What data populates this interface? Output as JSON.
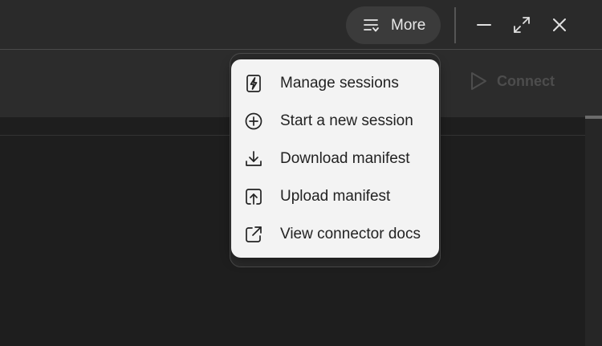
{
  "header": {
    "more_label": "More",
    "icons": {
      "more": "menu-list-icon",
      "minimize": "minimize-icon",
      "maximize": "maximize-icon",
      "close": "close-icon"
    }
  },
  "toolbar": {
    "connect_label": "Connect",
    "connect_icon": "play-icon"
  },
  "menu": {
    "items": [
      {
        "label": "Manage sessions",
        "icon": "lightning-document-icon"
      },
      {
        "label": "Start a new session",
        "icon": "plus-circle-icon"
      },
      {
        "label": "Download manifest",
        "icon": "download-icon"
      },
      {
        "label": "Upload manifest",
        "icon": "upload-icon"
      },
      {
        "label": "View connector docs",
        "icon": "external-link-icon"
      }
    ]
  },
  "colors": {
    "background": "#1e1e1e",
    "titlebar": "#2a2a2a",
    "menu_background": "#f3f3f3",
    "menu_text": "#222222",
    "disabled_text": "#4d4d4d"
  }
}
